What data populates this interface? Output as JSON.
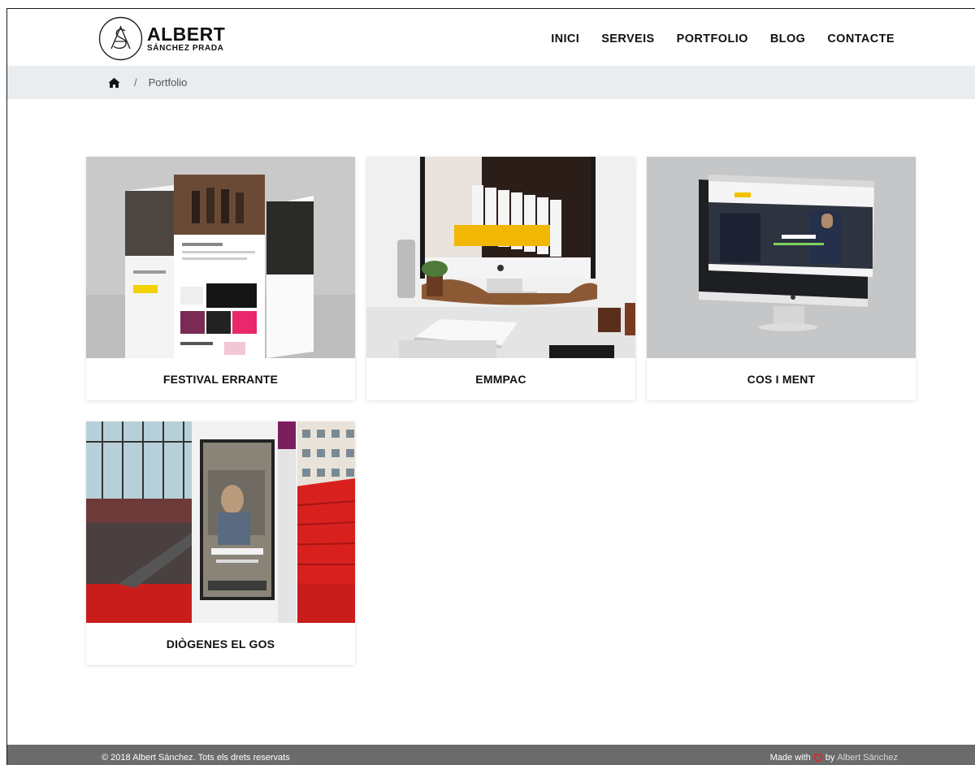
{
  "header": {
    "logo_name": "ALBERT",
    "logo_sub": "SÁNCHEZ PRADA",
    "nav": [
      {
        "label": "INICI"
      },
      {
        "label": "SERVEIS"
      },
      {
        "label": "PORTFOLIO"
      },
      {
        "label": "BLOG"
      },
      {
        "label": "CONTACTE"
      }
    ]
  },
  "breadcrumb": {
    "separator": "/",
    "current": "Portfolio"
  },
  "portfolio": {
    "items": [
      {
        "title": "FESTIVAL ERRANTE"
      },
      {
        "title": "EMMPAC"
      },
      {
        "title": "COS I MENT"
      },
      {
        "title": "DIÒGENES EL GOS"
      }
    ]
  },
  "footer": {
    "copyright": "© 2018 Albert Sánchez. Tots els drets reservats",
    "made_with": "Made with",
    "by": "by",
    "author": "Albert Sánchez"
  },
  "colors": {
    "breadcrumb_bg": "#e9edf0",
    "footer_bg": "#6b6b6b",
    "heart": "#e02424"
  }
}
